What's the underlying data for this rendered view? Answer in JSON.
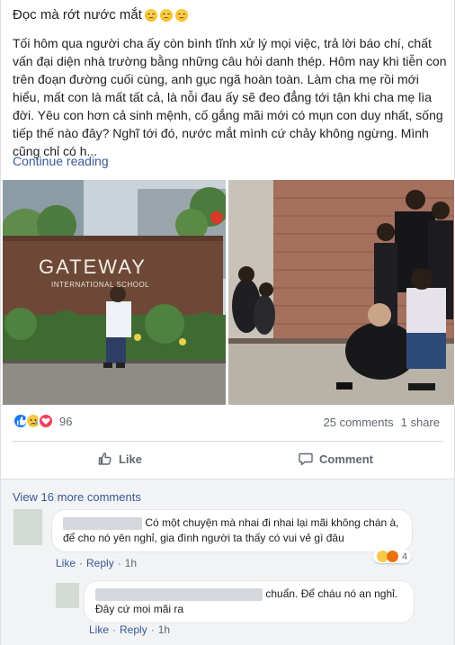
{
  "post": {
    "headline": "Đọc mà rớt nước mắt",
    "body": "Tối hôm qua người cha ấy còn bình tĩnh xử lý mọi việc, trả lời báo chí, chất vấn đại diện nhà trường bằng những câu hỏi danh thép. Hôm nay khi tiễn con trên đoạn đường cuối cùng, anh gục ngã hoàn toàn. Làm cha mẹ rồi mới hiểu, mất con là mất tất cả, là nỗi đau ấy sẽ đeo đẳng tới tận khi cha mẹ lìa đời. Yêu con hơn cả sinh mệnh, cố gắng mãi mới có mụn con duy nhất, sống tiếp thế nào đây? Nghĩ tới đó, nước mắt mình cứ chảy không ngừng. Mình cũng chỉ có h...",
    "continue_label": "Continue reading",
    "photo1_sign_line1": "GATEWAY",
    "photo1_sign_line2": "INTERNATIONAL SCHOOL"
  },
  "stats": {
    "reaction_count": "96",
    "comments": "25 comments",
    "shares": "1 share"
  },
  "actions": {
    "like": "Like",
    "comment": "Comment"
  },
  "comments_section": {
    "view_more": "View 16 more comments",
    "comment1": {
      "text": "Có một chuyện mà nhai đi nhai lại mãi không chán à, để cho nó yên nghỉ, gia đình người ta thấy có vui vẻ gì đâu",
      "like": "Like",
      "reply": "Reply",
      "time": "1h",
      "reaction_count": "4"
    },
    "reply1": {
      "text_line1": "chuẩn. Để cháu nó an nghỉ.",
      "text_line2": "Đây cứ moi mãi ra",
      "like": "Like",
      "reply": "Reply",
      "time": "1h"
    }
  },
  "colors": {
    "link": "#385898",
    "like_blue": "#1877f2",
    "love_red": "#f33e58",
    "sad_yellow": "#f7c948"
  }
}
